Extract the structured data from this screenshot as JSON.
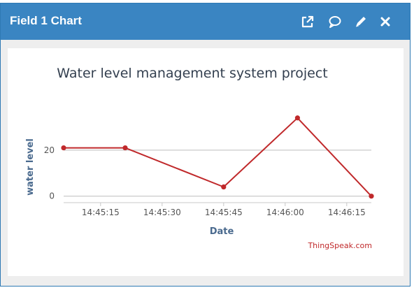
{
  "widget": {
    "title": "Field 1 Chart",
    "buttons": [
      {
        "name": "open-external-button",
        "icon": "external-link-icon"
      },
      {
        "name": "comment-button",
        "icon": "speech-bubble-icon"
      },
      {
        "name": "edit-button",
        "icon": "pencil-icon"
      },
      {
        "name": "close-button",
        "icon": "close-icon"
      }
    ],
    "header_color": "#3a85c2"
  },
  "chart_data": {
    "type": "line",
    "title": "Water level management system project",
    "xlabel": "Date",
    "ylabel": "water level",
    "credit": "ThingSpeak.com",
    "line_color": "#c0292b",
    "credit_color": "#c0292b",
    "x_is_time": true,
    "xlim": [
      "14:45:06",
      "14:46:21"
    ],
    "ylim": [
      -1,
      40
    ],
    "yticks": [
      0,
      20
    ],
    "ytick_labels": [
      "0",
      "20"
    ],
    "xticks": [
      "14:45:15",
      "14:45:30",
      "14:45:45",
      "14:46:00",
      "14:46:15"
    ],
    "xtick_labels": [
      "14:45:15",
      "14:45:30",
      "14:45:45",
      "14:46:00",
      "14:46:15"
    ],
    "grid": true,
    "series": [
      {
        "x": [
          "14:45:06",
          "14:45:21",
          "14:45:45",
          "14:46:03",
          "14:46:21"
        ],
        "y": [
          21,
          21,
          4,
          34,
          0
        ]
      }
    ]
  }
}
